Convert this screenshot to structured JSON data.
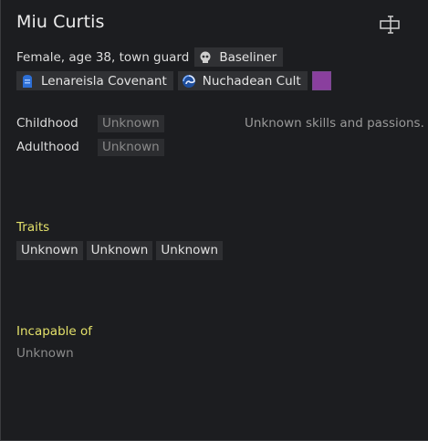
{
  "character": {
    "name": "Miu Curtis",
    "summary": "Female, age 38, town guard",
    "xenotype": "Baseliner",
    "factions": [
      {
        "name": "Lenareisla Covenant",
        "icon": "blue-banner-icon"
      },
      {
        "name": "Nuchadean Cult",
        "icon": "swirl-icon"
      }
    ],
    "favorite_color": "#8a3f9e"
  },
  "backstory": {
    "childhood_label": "Childhood",
    "childhood_value": "Unknown",
    "adulthood_label": "Adulthood",
    "adulthood_value": "Unknown"
  },
  "skills_text": "Unknown skills and passions.",
  "traits": {
    "heading": "Traits",
    "items": [
      "Unknown",
      "Unknown",
      "Unknown"
    ]
  },
  "incapable": {
    "heading": "Incapable of",
    "value": "Unknown"
  },
  "colors": {
    "heading_yellow": "#e3e06a",
    "panel_bg": "#1c1d20"
  }
}
